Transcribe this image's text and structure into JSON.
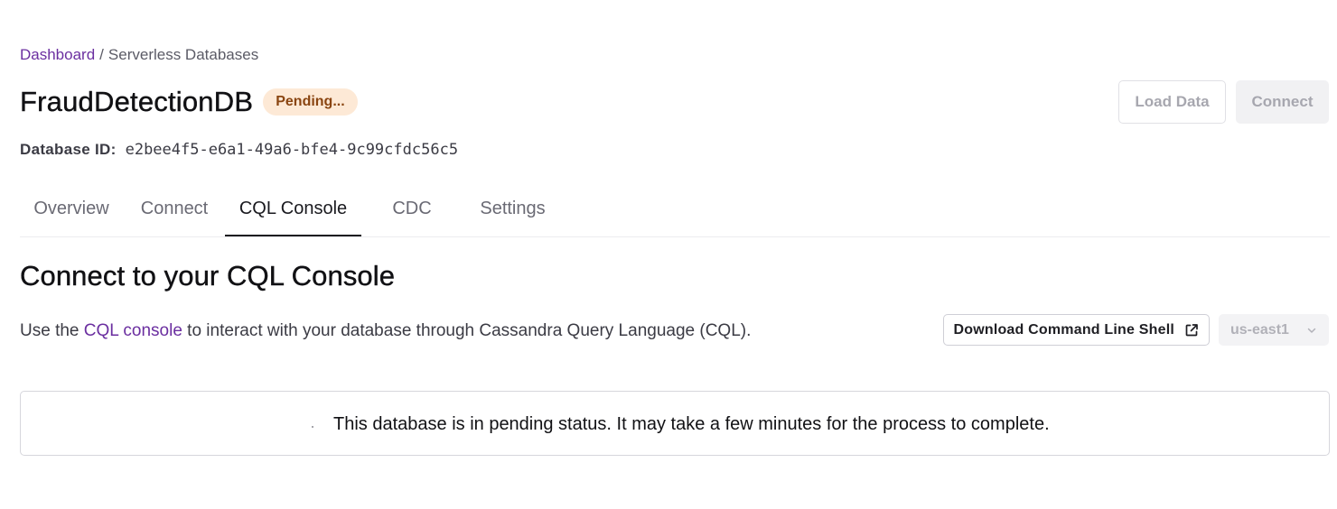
{
  "breadcrumb": {
    "root": "Dashboard",
    "separator": "/",
    "current": "Serverless Databases"
  },
  "database": {
    "name": "FraudDetectionDB",
    "status": "Pending...",
    "id_label": "Database ID:",
    "id_value": "e2bee4f5-e6a1-49a6-bfe4-9c99cfdc56c5"
  },
  "header_actions": {
    "load_data": "Load Data",
    "connect": "Connect"
  },
  "tabs": [
    {
      "label": "Overview",
      "active": false
    },
    {
      "label": "Connect",
      "active": false
    },
    {
      "label": "CQL Console",
      "active": true
    },
    {
      "label": "CDC",
      "active": false
    },
    {
      "label": "Settings",
      "active": false
    }
  ],
  "section": {
    "title": "Connect to your CQL Console",
    "desc_prefix": "Use the ",
    "desc_link": "CQL console",
    "desc_suffix": " to interact with your database through Cassandra Query Language (CQL)."
  },
  "section_actions": {
    "download_label": "Download Command Line Shell",
    "download_icon": "external-link-icon",
    "region_value": "us-east1",
    "region_icon": "chevron-down-icon"
  },
  "status_panel": {
    "message": "This database is in pending status. It may take a few minutes for the process to complete."
  },
  "colors": {
    "accent_link": "#6b2fa0",
    "badge_bg": "#fde9d6",
    "badge_text": "#8a4511",
    "disabled_text": "#a7a7af"
  }
}
